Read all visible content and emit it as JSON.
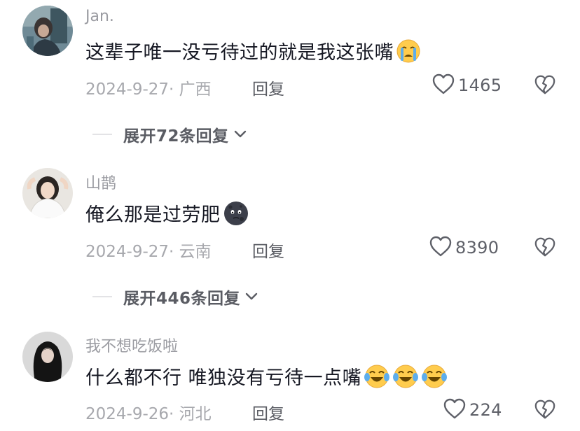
{
  "comments": [
    {
      "username": "Jan.",
      "text": "这辈子唯一没亏待过的就是我这张嘴",
      "emoji": "crying-face-emoji",
      "date": "2024-9-27",
      "location": "· 广西",
      "reply_label": "回复",
      "likes": "1465",
      "expand_label": "展开72条回复"
    },
    {
      "username": "山鹊",
      "text": "俺么那是过劳肥",
      "emoji": "new-moon-face-emoji",
      "date": "2024-9-27",
      "location": "· 云南",
      "reply_label": "回复",
      "likes": "8390",
      "expand_label": "展开446条回复"
    },
    {
      "username": "我不想吃饭啦",
      "text": "什么都不行 唯独没有亏待一点嘴",
      "emoji": "tears-of-joy-emoji",
      "date": "2024-9-26",
      "location": "· 河北",
      "reply_label": "回复",
      "likes": "224"
    }
  ],
  "icons": {
    "like": "heart-outline-icon",
    "dislike": "broken-heart-icon",
    "expand": "chevron-down-icon"
  },
  "colors": {
    "text": "#161823",
    "muted": "#a7a8ad",
    "username": "#9a9ba1",
    "icon": "#5e6068"
  }
}
